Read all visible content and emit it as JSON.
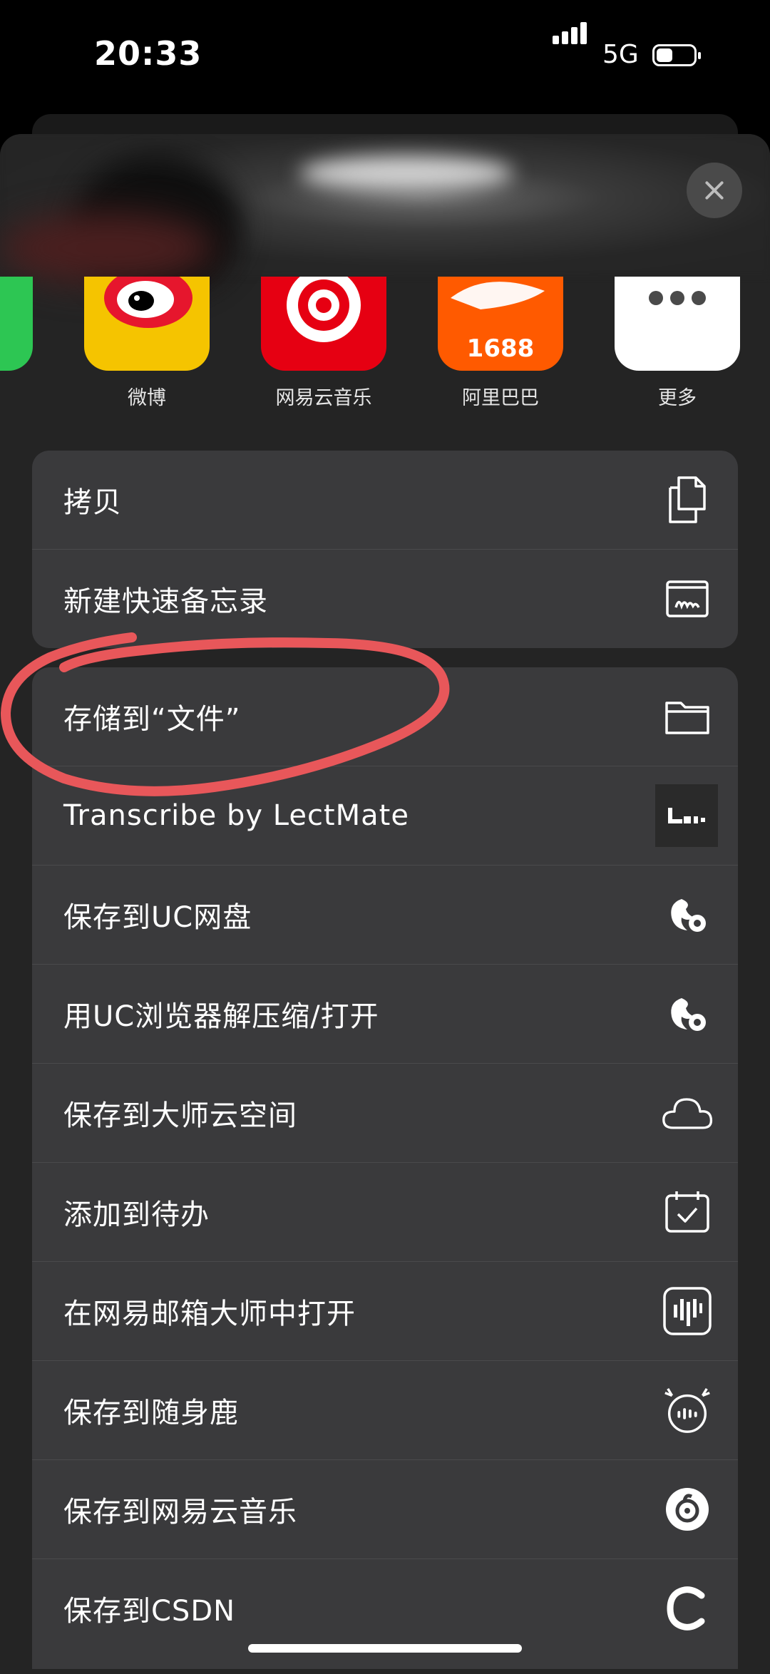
{
  "status_bar": {
    "time": "20:33",
    "network": "5G"
  },
  "apps": [
    {
      "label": "微博",
      "icon": "weibo-icon"
    },
    {
      "label": "网易云音乐",
      "icon": "netease-music-icon"
    },
    {
      "label": "阿里巴巴",
      "icon": "alibaba-1688-icon",
      "badge": "1688"
    },
    {
      "label": "更多",
      "icon": "more-icon"
    }
  ],
  "group1": [
    {
      "label": "拷贝",
      "icon": "copy-icon"
    },
    {
      "label": "新建快速备忘录",
      "icon": "quick-note-icon"
    }
  ],
  "group2": [
    {
      "label": "存储到“文件”",
      "icon": "folder-icon"
    },
    {
      "label": "Transcribe by LectMate",
      "icon": "lectmate-icon"
    },
    {
      "label": "保存到UC网盘",
      "icon": "uc-squirrel-icon"
    },
    {
      "label": "用UC浏览器解压缩/打开",
      "icon": "uc-squirrel-icon"
    },
    {
      "label": "保存到大师云空间",
      "icon": "cloud-icon"
    },
    {
      "label": "添加到待办",
      "icon": "calendar-check-icon"
    },
    {
      "label": "在网易邮箱大师中打开",
      "icon": "mail-master-icon"
    },
    {
      "label": "保存到随身鹿",
      "icon": "deer-icon"
    },
    {
      "label": "保存到网易云音乐",
      "icon": "netease-music-small-icon"
    },
    {
      "label": "保存到CSDN",
      "icon": "csdn-icon"
    }
  ],
  "colors": {
    "sheet": "#242424",
    "group": "#3a3a3c",
    "annotation": "#e8575a",
    "weibo_bg": "#f5c400",
    "netease_red": "#e60012",
    "alibaba_orange": "#ff5a00"
  }
}
